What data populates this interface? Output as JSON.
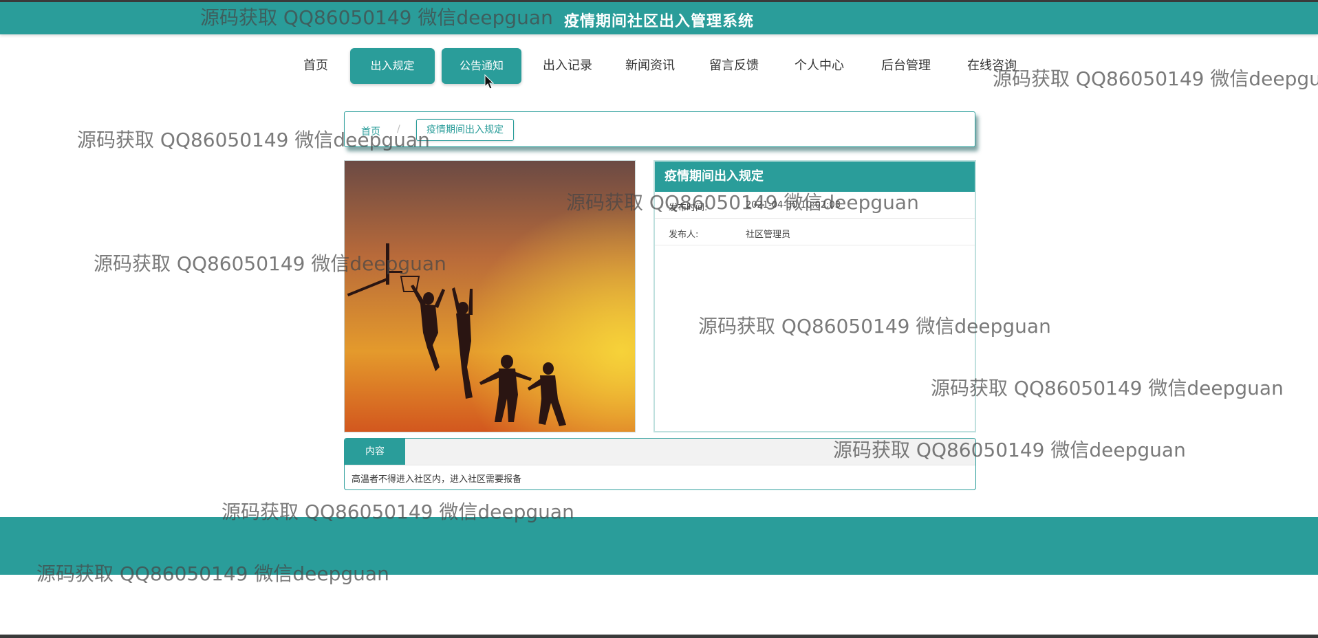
{
  "header": {
    "site_title": "疫情期间社区出入管理系统"
  },
  "nav": {
    "items": [
      {
        "label": "首页"
      },
      {
        "label": "出入规定"
      },
      {
        "label": "公告通知"
      },
      {
        "label": "出入记录"
      },
      {
        "label": "新闻资讯"
      },
      {
        "label": "留言反馈"
      },
      {
        "label": "个人中心"
      },
      {
        "label": "后台管理"
      },
      {
        "label": "在线咨询"
      }
    ]
  },
  "breadcrumb": {
    "home": "首页",
    "separator": "/",
    "current": "疫情期间出入规定"
  },
  "detail": {
    "title": "疫情期间出入规定",
    "publish_time_label": "发布时间:",
    "publish_time_value": "2021-04-30 10:02:03",
    "publisher_label": "发布人:",
    "publisher_value": "社区管理员"
  },
  "content": {
    "tab_label": "内容",
    "text": "高温者不得进入社区内，进入社区需要报备"
  },
  "watermark": {
    "text": "源码获取 QQ86050149 微信deepguan"
  },
  "colors": {
    "primary": "#2a9d9a",
    "header_border": "#3a3a3a"
  }
}
